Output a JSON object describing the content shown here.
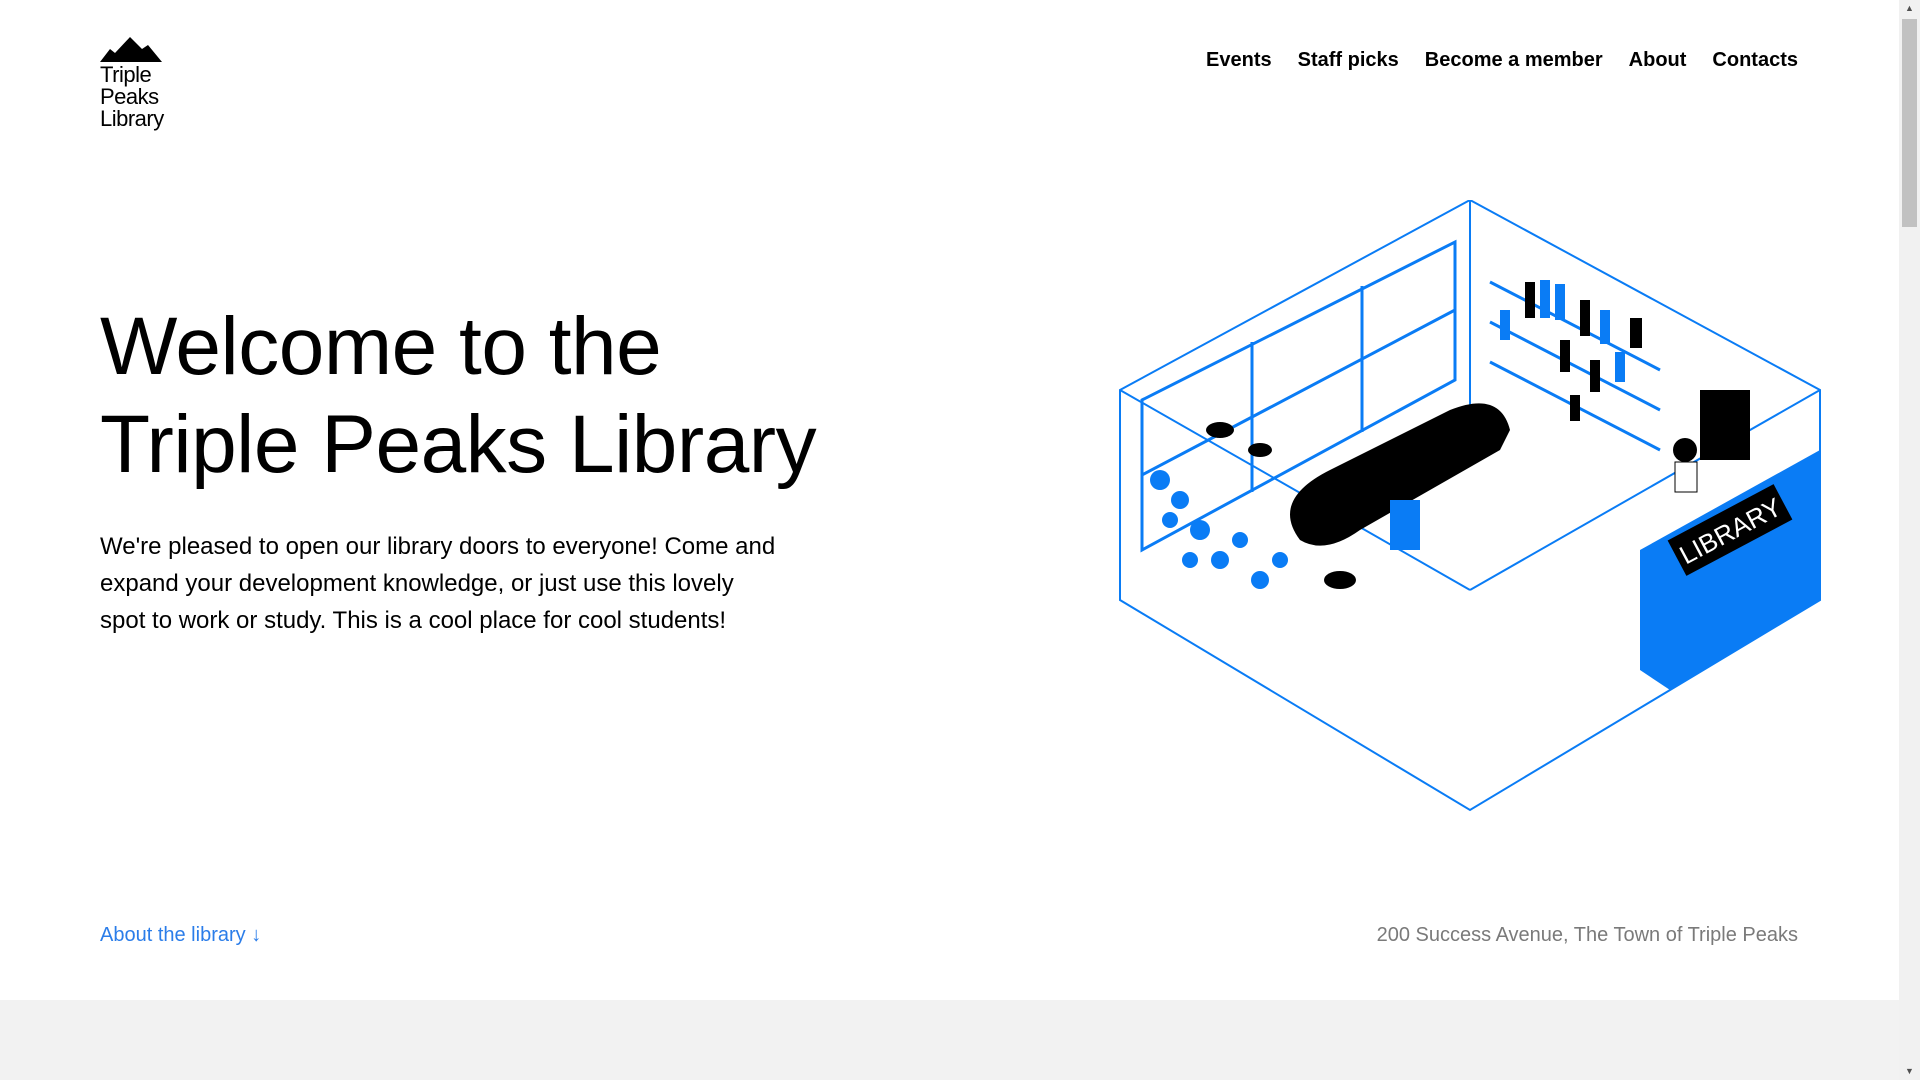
{
  "logo": {
    "lines": [
      "Triple",
      "Peaks",
      "Library"
    ],
    "icon": "mountain-peaks-icon"
  },
  "nav": {
    "items": [
      "Events",
      "Staff picks",
      "Become a member",
      "About",
      "Contacts"
    ]
  },
  "hero": {
    "title_line1": "Welcome to the",
    "title_line2": "Triple Peaks Library",
    "description": "We're pleased to open our library doors to everyone! Come and expand your development knowledge, or just use this lovely spot to work or study. This is a cool place for cool students!",
    "illustration_icon": "isometric-library-room-illustration",
    "sign_text": "LIBRARY"
  },
  "footer": {
    "about_link": "About the library ↓",
    "address": "200 Success Avenue, The Town of Triple Peaks"
  },
  "colors": {
    "accent": "#0a7cf5",
    "link": "#2b7de9",
    "muted": "#7a7a7a",
    "band": "#f2f2f2"
  },
  "scrollbar": {
    "up_icon": "scroll-up-arrow-icon",
    "down_icon": "scroll-down-arrow-icon"
  }
}
